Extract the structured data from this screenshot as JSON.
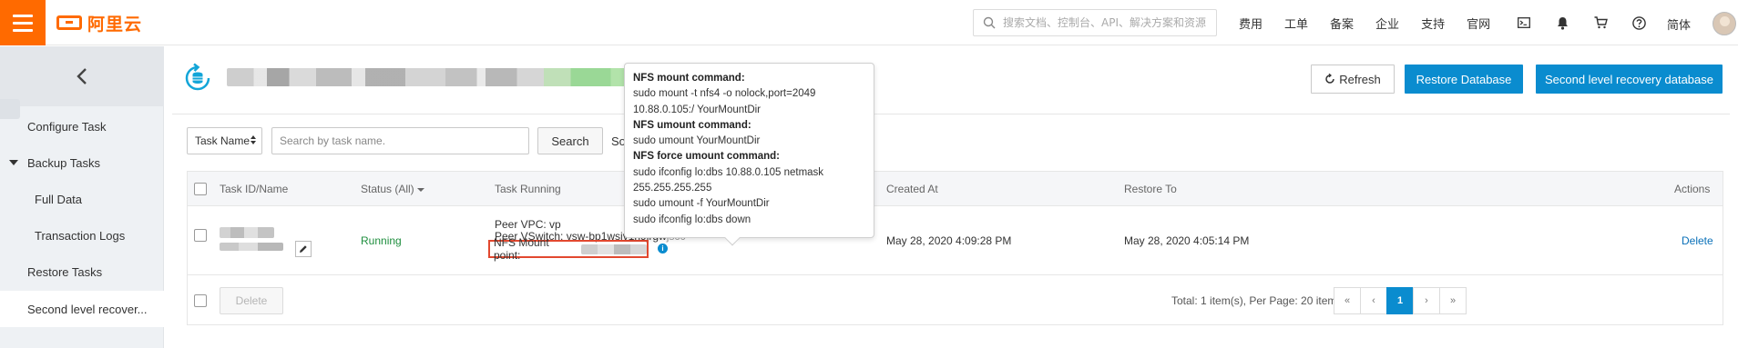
{
  "brand": {
    "logo_text": "阿里云",
    "accent": "#ff6a00"
  },
  "topbar": {
    "search_placeholder": "搜索文档、控制台、API、解决方案和资源",
    "links": [
      "费用",
      "工单",
      "备案",
      "企业",
      "支持",
      "官网"
    ],
    "icons": [
      "terminal-icon",
      "bell-icon",
      "cart-icon",
      "help-icon"
    ],
    "language": "简体"
  },
  "sidebar": {
    "items": [
      {
        "label": "Configure Task"
      },
      {
        "label": "Backup Tasks"
      },
      {
        "label": "Full Data"
      },
      {
        "label": "Transaction Logs"
      },
      {
        "label": "Restore Tasks"
      },
      {
        "label": "Second level recover..."
      }
    ]
  },
  "header": {
    "refresh_label": "Refresh",
    "restore_db_label": "Restore Database",
    "second_level_label": "Second level recovery database"
  },
  "filter": {
    "select_value": "Task Name",
    "search_placeholder": "Search by task name.",
    "search_button": "Search",
    "sort_text": "So"
  },
  "table": {
    "headers": {
      "task": "Task ID/Name",
      "status": "Status (All)",
      "running": "Task Running",
      "created": "Created At",
      "restore_to": "Restore To",
      "actions": "Actions"
    },
    "row": {
      "status": "Running",
      "peer_vpc": "Peer VPC: vp",
      "peer_vswitch": "Peer VSwitch: vsw-bp1wsiv1n9jrgw",
      "peer_vswitch_tail": "jsc0",
      "nfs_mount": "NFS Mount point:",
      "created_at": "May 28, 2020 4:09:28 PM",
      "restore_to": "May 28, 2020 4:05:14 PM",
      "action": "Delete"
    },
    "footer": {
      "delete_label": "Delete",
      "total": "Total: 1 item(s), Per Page: 20 item(s)",
      "pager": [
        "«",
        "‹",
        "1",
        "›",
        "»"
      ],
      "current_page": "1"
    }
  },
  "popover": {
    "mount_title": "NFS mount command:",
    "mount_line1": "sudo mount -t nfs4 -o nolock,port=2049",
    "mount_line2": "10.88.0.105:/ YourMountDir",
    "umount_title": "NFS umount command:",
    "umount_line": "sudo umount YourMountDir",
    "force_title": "NFS force umount command:",
    "force_line1": "sudo ifconfig lo:dbs 10.88.0.105 netmask",
    "force_line2": "255.255.255.255",
    "force_line3": "sudo umount -f YourMountDir",
    "force_line4": "sudo ifconfig lo:dbs down"
  }
}
